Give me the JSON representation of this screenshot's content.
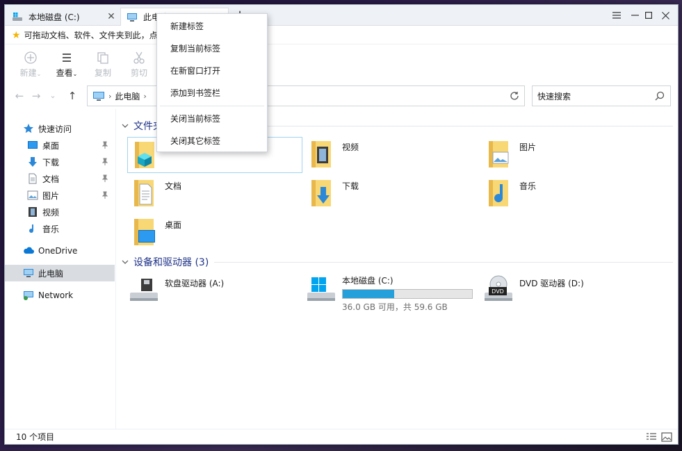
{
  "tabs": [
    {
      "label": "本地磁盘 (C:)",
      "close": "✕"
    },
    {
      "label": "此电脑",
      "close": "✕"
    }
  ],
  "tab_add": "+",
  "bookmark_bar": {
    "text": "可拖动文档、软件、文件夹到此，点"
  },
  "toolbar": {
    "new": "新建",
    "view": "查看",
    "copy": "复制",
    "cut": "剪切"
  },
  "address": {
    "crumbs": [
      "此电脑"
    ],
    "search_placeholder": "快速搜索"
  },
  "nav": {
    "quick_access": "快速访问",
    "items": [
      "桌面",
      "下载",
      "文档",
      "图片",
      "视频",
      "音乐"
    ],
    "onedrive": "OneDrive",
    "this_pc": "此电脑",
    "network": "Network"
  },
  "content": {
    "folders_header": "文件夹",
    "folders": [
      "视频",
      "图片",
      "文档",
      "下载",
      "音乐",
      "桌面"
    ],
    "devices_header": "设备和驱动器 (3)",
    "drives": [
      {
        "label": "软盘驱动器 (A:)"
      },
      {
        "label": "本地磁盘 (C:)",
        "detail": "36.0 GB 可用，共 59.6 GB",
        "used_fraction": 0.4
      },
      {
        "label": "DVD 驱动器 (D:)",
        "badge": "DVD"
      }
    ]
  },
  "status": {
    "count": "10 个项目"
  },
  "context_menu": {
    "items": [
      "新建标签",
      "复制当前标签",
      "在新窗口打开",
      "添加到书签栏",
      "关闭当前标签",
      "关闭其它标签"
    ]
  },
  "colors": {
    "accent": "#26a0da",
    "header": "#1e3287",
    "folder": "#f8d775"
  }
}
